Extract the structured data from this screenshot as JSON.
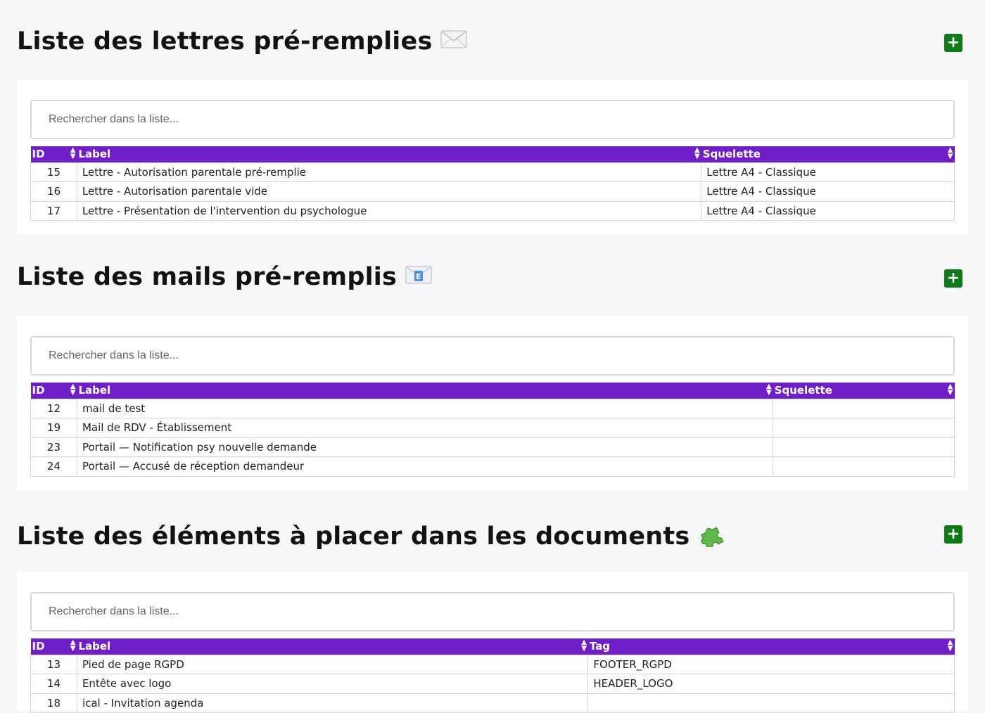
{
  "sections": [
    {
      "title": "Liste des lettres pré-remplies",
      "title_icon": "envelope-icon",
      "add_label": "+",
      "search_placeholder": "Rechercher dans la liste...",
      "columns": [
        "ID",
        "Label",
        "Squelette"
      ],
      "rows": [
        [
          "15",
          "Lettre - Autorisation parentale pré-remplie",
          "Lettre A4 - Classique"
        ],
        [
          "16",
          "Lettre - Autorisation parentale vide",
          "Lettre A4 - Classique"
        ],
        [
          "17",
          "Lettre - Présentation de l'intervention du psychologue",
          "Lettre A4 - Classique"
        ]
      ]
    },
    {
      "title": "Liste des mails pré-remplis",
      "title_icon": "e-mail-icon",
      "add_label": "+",
      "search_placeholder": "Rechercher dans la liste...",
      "columns": [
        "ID",
        "Label",
        "Squelette"
      ],
      "rows": [
        [
          "12",
          "mail de test",
          ""
        ],
        [
          "19",
          "Mail de RDV - Établissement",
          ""
        ],
        [
          "23",
          "Portail — Notification psy nouvelle demande",
          ""
        ],
        [
          "24",
          "Portail — Accusé de réception demandeur",
          ""
        ]
      ]
    },
    {
      "title": "Liste des éléments à placer dans les documents",
      "title_icon": "puzzle-piece-icon",
      "add_label": "+",
      "search_placeholder": "Rechercher dans la liste...",
      "columns": [
        "ID",
        "Label",
        "Tag"
      ],
      "rows": [
        [
          "13",
          "Pied de page RGPD",
          "FOOTER_RGPD"
        ],
        [
          "14",
          "Entête avec logo",
          "HEADER_LOGO"
        ],
        [
          "18",
          "ical - Invitation agenda",
          ""
        ]
      ]
    }
  ],
  "colors": {
    "header_bg": "#6f1fc6",
    "add_button": "#0f7a17",
    "page_bg": "#f7f7f9"
  }
}
